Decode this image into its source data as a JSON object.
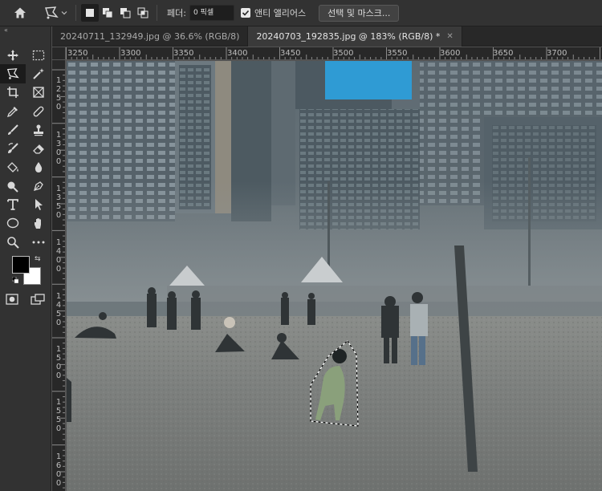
{
  "options_bar": {
    "feather_label": "페더:",
    "feather_value": "0 픽셀",
    "antialias_label": "앤티 앨리어스",
    "antialias_checked": true,
    "select_mask_label": "선택 및 마스크..."
  },
  "tabs": [
    {
      "label": "20240711_132949.jpg @ 36.6% (RGB/8)",
      "active": false
    },
    {
      "label": "20240703_192835.jpg @ 183% (RGB/8) *",
      "active": true
    }
  ],
  "ruler_top": [
    "3250",
    "3300",
    "3350",
    "3400",
    "3450",
    "3500",
    "3550",
    "3600",
    "3650",
    "3700"
  ],
  "ruler_left": [
    "1250",
    "1300",
    "1350",
    "1400",
    "1450",
    "1500",
    "1550",
    "1600"
  ],
  "colors": {
    "foreground": "#000000",
    "background": "#ffffff"
  },
  "tool_icons": [
    "move-icon",
    "rect-marquee-icon",
    "polygonal-lasso-icon",
    "magic-wand-icon",
    "crop-icon",
    "frame-icon",
    "eyedropper-icon",
    "healing-brush-icon",
    "brush-icon",
    "clone-stamp-icon",
    "history-brush-icon",
    "eraser-icon",
    "paint-bucket-icon",
    "blur-icon",
    "dodge-icon",
    "pen-icon",
    "type-icon",
    "path-selection-icon",
    "ellipse-icon",
    "hand-icon",
    "zoom-icon",
    "more-icon"
  ]
}
